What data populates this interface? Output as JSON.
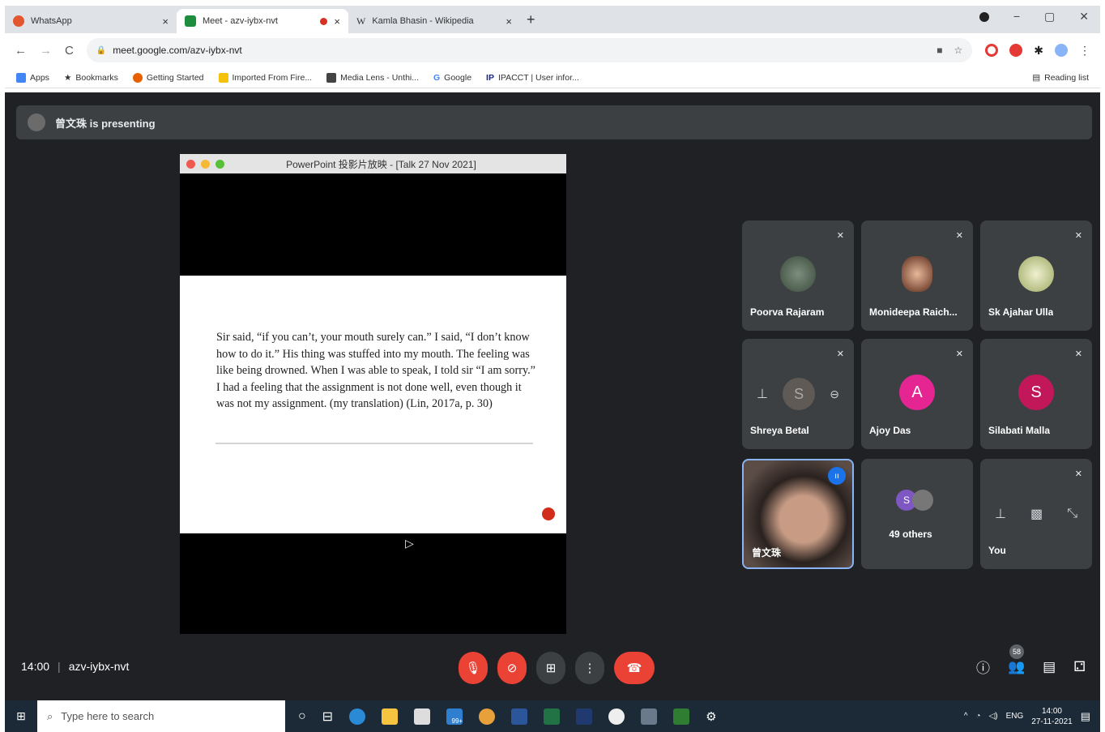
{
  "browser": {
    "tabs": [
      {
        "title": "WhatsApp",
        "close": "×",
        "favicon_color": "#e4572e"
      },
      {
        "title": "Meet - azv-iybx-nvt",
        "close": "×",
        "favicon_color": "#1e8e3e",
        "recording_dot_color": "#d93025"
      },
      {
        "title": "Kamla Bhasin - Wikipedia",
        "close": "×",
        "favicon_color": "#333333"
      }
    ],
    "new_tab": "+",
    "window_controls": {
      "minimize": "−",
      "maximize": "▢",
      "close": "✕"
    },
    "nav": {
      "back": "←",
      "forward": "→",
      "reload": "C"
    },
    "url": "meet.google.com/azv-iybx-nvt",
    "bookmarks": [
      {
        "label": "Apps",
        "icon": "apps-grid-icon",
        "color": "#4285f4"
      },
      {
        "label": "Bookmarks",
        "icon": "star-icon",
        "color": "#222222"
      },
      {
        "label": "Getting Started",
        "icon": "firefox-icon",
        "color": "#e66000"
      },
      {
        "label": "Imported From Fire...",
        "icon": "folder-icon",
        "color": "#f4c20d"
      },
      {
        "label": "Media Lens - Unthi...",
        "icon": "media-lens-icon",
        "color": "#444444"
      },
      {
        "label": "Google",
        "icon": "google-icon",
        "color": "#4285f4"
      },
      {
        "label": "IPACCT | User infor...",
        "icon": "ipacct-icon",
        "color": "#1a237e"
      }
    ],
    "reading_list": "Reading list"
  },
  "meet": {
    "presenter_banner": "曾文珠 is presenting",
    "slide": {
      "window_title": "PowerPoint 投影片放映 - [Talk 27 Nov 2021]",
      "body": "Sir said, “if you can’t, your mouth surely can.” I said, “I don’t know how to do it.” His thing was stuffed into my mouth. The feeling was like being drowned. When I was able to speak, I told sir “I am sorry.” I had a feeling that the assignment is not done well, even though it was not my assignment. (my translation) (Lin, 2017a, p. 30)"
    },
    "participants": [
      {
        "name": "Poorva Rajaram",
        "avatar": "photo",
        "color": "#4a5a4a"
      },
      {
        "name": "Monideepa Raich...",
        "avatar": "photo",
        "color": "#8d5a3c"
      },
      {
        "name": "Sk Ajahar Ulla",
        "avatar": "photo",
        "color": "#b5c07a"
      },
      {
        "name": "Shreya Betal",
        "avatar": "S",
        "color": "#8a6a5a"
      },
      {
        "name": "Ajoy Das",
        "avatar": "A",
        "color": "#e52592"
      },
      {
        "name": "Silabati Malla",
        "avatar": "S",
        "color": "#c2185b"
      }
    ],
    "speaker": {
      "name": "曾文珠"
    },
    "others": {
      "label": "49 others",
      "initial": "S",
      "color": "#7e57c2"
    },
    "self": {
      "name": "You"
    },
    "time": "14:00",
    "meeting_code": "azv-iybx-nvt",
    "people_count": "58"
  },
  "taskbar": {
    "search_placeholder": "Type here to search",
    "lang": "ENG",
    "time": "14:00",
    "date": "27-11-2021",
    "mail_badge": "99+"
  }
}
